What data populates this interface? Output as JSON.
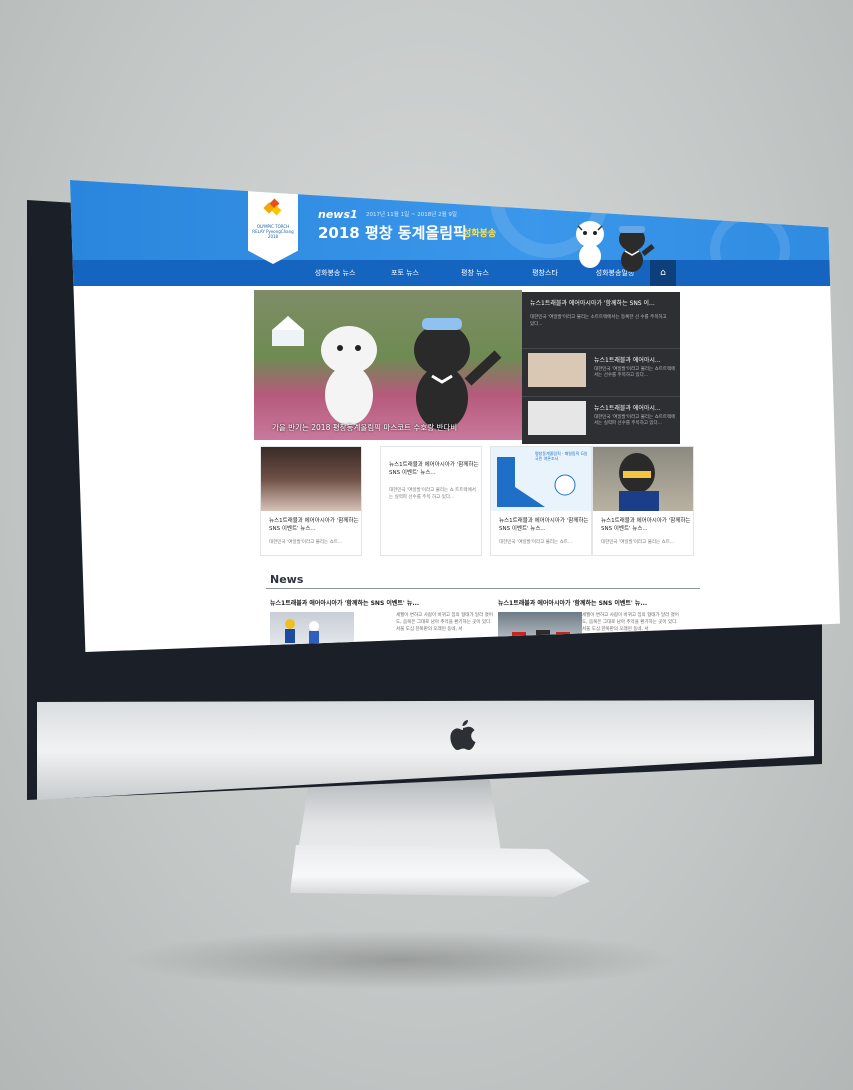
{
  "site": {
    "brand": "news1",
    "period": "2017년 11월 1일 ~ 2018년 2월 9일",
    "headline": "2018 평창 동계올림픽",
    "headline_accent": "성화봉송",
    "logo_text": "OLYMPIC TORCH RELAY PyeongChang 2018"
  },
  "nav": {
    "items": [
      {
        "label": "성화봉송 뉴스"
      },
      {
        "label": "포토 뉴스"
      },
      {
        "label": "평창 뉴스"
      },
      {
        "label": "평창스타"
      },
      {
        "label": "성화봉송일정"
      }
    ],
    "home_label": "⌂"
  },
  "hero": {
    "caption": "가을 반기는 2018 평창동계올림픽 마스코트 수호랑 반다비"
  },
  "side": {
    "top_title": "뉴스1트래블과 에어아시아가 '함께하는 SNS 이...",
    "top_desc": "대한민국 '여일발'이라고 불리는 소트트랙에서는 등록한 선 수를 주목하고 있다...",
    "rows": [
      {
        "title": "뉴스1트래블과 에어아시...",
        "desc": "대한민국 '여일발'이라고 불리는 쇼트트랙에서는 선수를 주목하고 있다..."
      },
      {
        "title": "뉴스1트래블과 에어아시...",
        "desc": "대한민국 '여일발'이라고 불리는 쇼트트랙에서는 실력파 선수를 주목하고 있다..."
      }
    ]
  },
  "cards": [
    {
      "title": "뉴스1트래블과 에어아시아가 '함께하는 SNS 이벤트' 뉴스...",
      "desc": "대한민국 '여일발'이라고 불리는 쇼트..."
    },
    {
      "title": "뉴스1트래블과 에어아시아가 '함께하는 SNS 이벤트' 뉴스...",
      "desc": "대한민국 '여일발'이라고 불리는 쇼 트트랙에서는 실력파 선수를 주목 하고 있다..."
    },
    {
      "title": "뉴스1트래블과 에어아시아가 '함께하는 SNS 이벤트' 뉴스...",
      "desc": "대한민국 '여일발'이라고 불리는 쇼트...",
      "img_caption": "평창동계올림픽 · 패럴림픽 G일 국민 여론조사"
    },
    {
      "title": "뉴스1트래블과 에어아시아가 '함께하는 SNS 이벤트' 뉴스...",
      "desc": "대한민국 '여일발'이라고 불리는 쇼트..."
    }
  ],
  "news_section": {
    "title": "News",
    "items": [
      {
        "title": "뉴스1트래블과 에어아시아가 '함께하는 SNS 이벤트' 뉴...",
        "desc": "세월이 변하고 사람이 바뀌고 집의 형태가 달라 졌어 도, 음복은 그대로 남아 추억을 환기하는 곳이 있다. 서울 도심 한복판의 오래된 동네, 서"
      },
      {
        "title": "뉴스1트래블과 에어아시아가 '함께하는 SNS 이벤트' 뉴...",
        "desc": "세월이 변하고 사람이 바뀌고 집의 형태가 달라 졌어 도, 음복은 그대로 남아 추억을 환기하는 곳이 있다. 서울 도심 한복판의 오래된 동네, 서"
      }
    ]
  },
  "colors": {
    "header_blue": "#2f8be0",
    "nav_blue": "#1565c0",
    "accent_yellow": "#ffe14a",
    "side_panel": "#2d2f33"
  }
}
